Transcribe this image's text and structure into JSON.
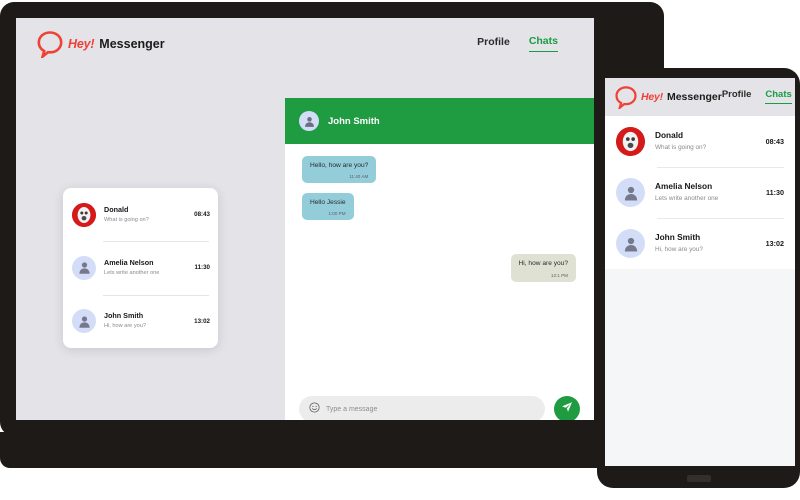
{
  "brand": {
    "hey": "Hey!",
    "name": "Messenger",
    "logo_icon": "speech-bubble-icon",
    "color": "#ef4136"
  },
  "theme": {
    "accent_green": "#1f9c42",
    "incoming_bubble": "#93cdd9",
    "outgoing_bubble": "#dfe1d2",
    "screen_bg": "#e3e3e8"
  },
  "desktop": {
    "nav": {
      "profile": "Profile",
      "chats": "Chats",
      "active": "Chats"
    },
    "chat_list": [
      {
        "name": "Donald",
        "preview": "What is going on?",
        "time": "08:43",
        "avatar": "photo-avatar"
      },
      {
        "name": "Amelia Nelson",
        "preview": "Lets write another one",
        "time": "11:30",
        "avatar": "person-avatar"
      },
      {
        "name": "John Smith",
        "preview": "Hi, how are you?",
        "time": "13:02",
        "avatar": "person-avatar"
      }
    ],
    "conversation": {
      "title": "John Smith",
      "avatar": "person-avatar",
      "messages": [
        {
          "text": "Hello, how are you?",
          "time": "11:40 AM",
          "side": "in"
        },
        {
          "text": "Hello Jessie",
          "time": "1:00 PM",
          "side": "in"
        },
        {
          "text": "Hi, how are you?",
          "time": "12:1 PM",
          "side": "out"
        }
      ],
      "composer": {
        "placeholder": "Type a message",
        "emoji_icon": "smiley-icon",
        "send_icon": "paper-plane-icon"
      }
    }
  },
  "mobile": {
    "nav": {
      "profile": "Profile",
      "chats": "Chats",
      "active": "Chats"
    },
    "chat_list": [
      {
        "name": "Donald",
        "preview": "What is going on?",
        "time": "08:43",
        "avatar": "photo-avatar"
      },
      {
        "name": "Amelia Nelson",
        "preview": "Lets write another one",
        "time": "11:30",
        "avatar": "person-avatar"
      },
      {
        "name": "John Smith",
        "preview": "Hi, how are you?",
        "time": "13:02",
        "avatar": "person-avatar"
      }
    ]
  }
}
